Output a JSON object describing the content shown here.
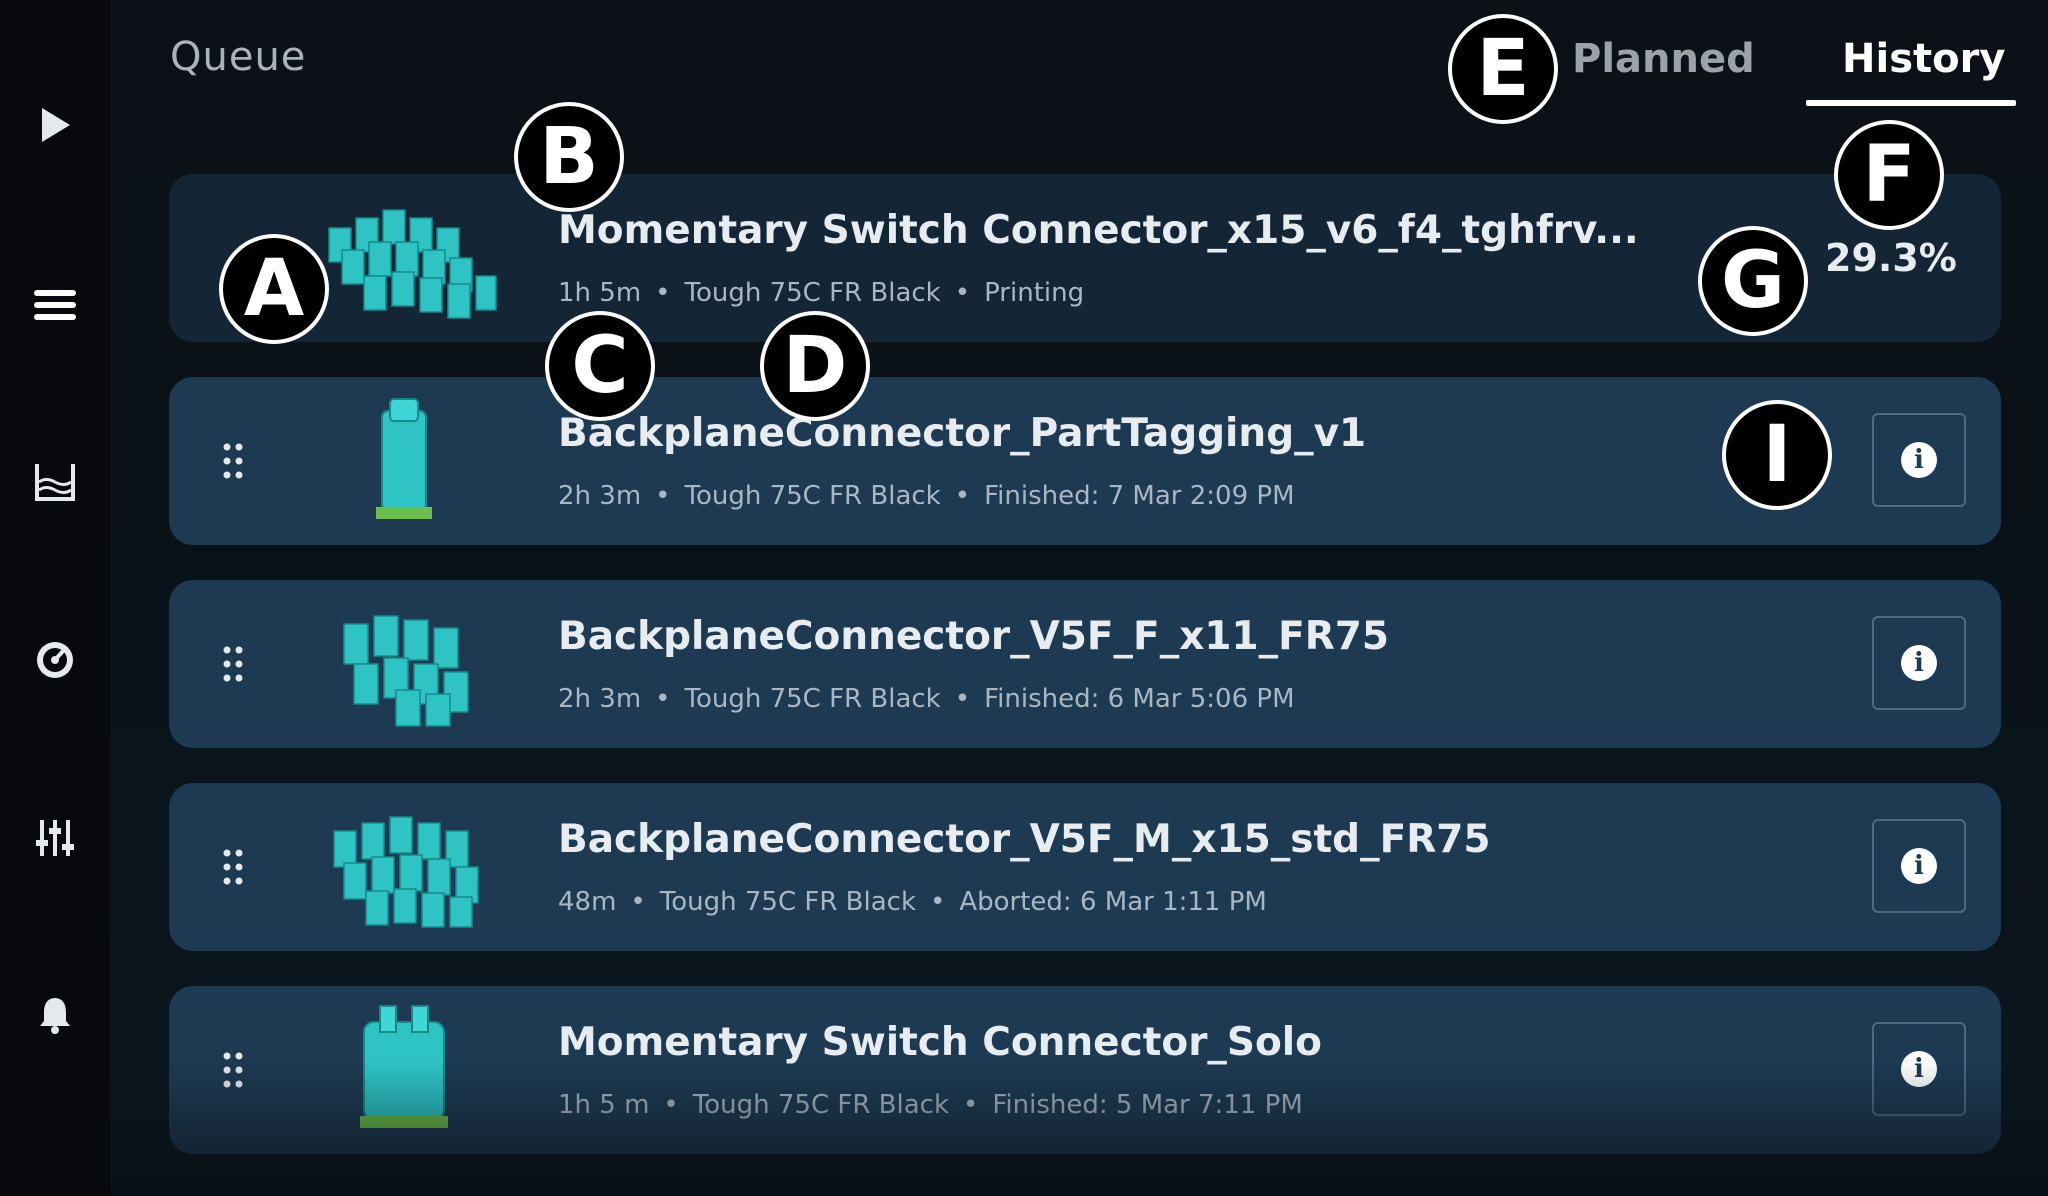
{
  "header": {
    "queue_title": "Queue",
    "tabs": [
      {
        "label": "Planned",
        "active": false
      },
      {
        "label": "History",
        "active": true
      }
    ]
  },
  "sidebar": {
    "icons": [
      "play-icon",
      "menu-icon",
      "tank-icon",
      "gauge-icon",
      "sliders-icon",
      "bell-icon"
    ]
  },
  "jobs": [
    {
      "title": "Momentary Switch Connector_x15_v6_f4_tghfrv...",
      "duration": "1h 5m",
      "material": "Tough 75C FR Black",
      "status": "Printing",
      "progress": "29.3%"
    },
    {
      "title": "BackplaneConnector_PartTagging_v1",
      "duration": "2h 3m",
      "material": "Tough 75C FR Black",
      "status": "Finished: 7 Mar 2:09 PM"
    },
    {
      "title": "BackplaneConnector_V5F_F_x11_FR75",
      "duration": "2h 3m",
      "material": "Tough 75C FR Black",
      "status": "Finished: 6 Mar 5:06 PM"
    },
    {
      "title": "BackplaneConnector_V5F_M_x15_std_FR75",
      "duration": "48m",
      "material": "Tough 75C FR Black",
      "status": "Aborted: 6 Mar 1:11 PM"
    },
    {
      "title": "Momentary Switch Connector_Solo",
      "duration": "1h 5 m",
      "material": "Tough 75C FR Black",
      "status": "Finished: 5 Mar 7:11 PM"
    }
  ],
  "annotations": {
    "a": "A",
    "b": "B",
    "c": "C",
    "d": "D",
    "e": "E",
    "f": "F",
    "g": "G",
    "i": "I"
  },
  "colors": {
    "card_active": "#142536",
    "card": "#1d3a52",
    "part_teal": "#2ec4c4"
  }
}
